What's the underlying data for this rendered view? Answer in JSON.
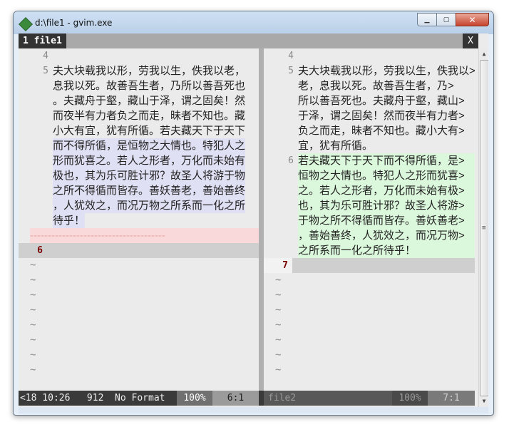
{
  "window": {
    "title": "d:\\file1  - gvim.exe",
    "icon": "gvim-icon"
  },
  "tabline": {
    "tab_label": "1 file1",
    "close_label": "X"
  },
  "left_pane": {
    "numbers": [
      "4",
      "5",
      "6"
    ],
    "lines": [
      "夫大块载我以形，劳我以生，佚我以老，",
      "息我以死。故善吾生者，乃所以善吾死也",
      "。夫藏舟于壑，藏山于泽，谓之固矣！然",
      "而夜半有力者负之而走，昧者不知也。藏",
      "小大有宜，犹有所循。若夫藏天下于天下",
      "而不得所循，是恒物之大情也。特犯人之",
      "形而犹喜之。若人之形者，万化而未始有",
      "极也，其为乐可胜计邪？故圣人将游于物",
      "之所不得循而皆存。善妖善老，善始善终",
      "，人犹效之，而况万物之所系而一化之所",
      "待乎！"
    ],
    "deleted_marker": "--------------------------------------",
    "tildes": [
      "~",
      "~",
      "~",
      "~",
      "~",
      "~",
      "~",
      "~"
    ]
  },
  "right_pane": {
    "numbers": [
      "4",
      "5",
      "6",
      "7"
    ],
    "lines_5": [
      "夫大块载我以形，劳我以生，佚我以>",
      "老，息我以死。故善吾生者，乃>",
      "所以善吾死也。夫藏舟于壑，藏山>",
      "于泽，谓之固矣！然而夜半有力者>",
      "负之而走，昧者不知也。藏小大有>",
      "宜，犹有所循。"
    ],
    "lines_6": [
      "若夫藏天下于天下而不得所循，是>",
      "恒物之大情也。特犯人之形而犹喜>",
      "之。若人之形者，万化而未始有极>",
      "也，其为乐可胜计邪？故圣人将游>",
      "于物之所不得循而皆存。善妖善老>",
      "，善始善终，人犹效之，而况万物>",
      "之所系而一化之所待乎！"
    ],
    "tildes": [
      "~",
      "~",
      "~",
      "~",
      "~",
      "~",
      "~"
    ]
  },
  "statusline_left": {
    "text": "<18 10:26   912  No Format",
    "percent": "100%",
    "position": "6:1"
  },
  "statusline_right": {
    "text": "file2",
    "percent": "100%",
    "position": "7:1"
  },
  "colors": {
    "diff_add": "#dcf8dc",
    "diff_change": "#e0e0f4",
    "diff_delete": "#f9d9d9",
    "filler": "#cfcfcf"
  }
}
